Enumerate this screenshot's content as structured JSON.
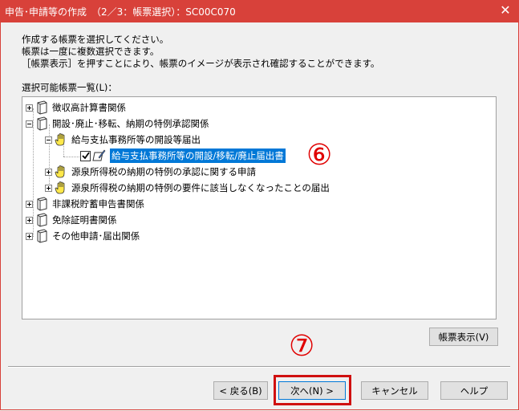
{
  "window": {
    "title": "申告･申請等の作成　（2／3：帳票選択）：SC00C070",
    "close_glyph": "✕"
  },
  "instructions": {
    "line1": "作成する帳票を選択してください。",
    "line2": "帳票は一度に複数選択できます。",
    "line3": "［帳票表示］を押すことにより、帳票のイメージが表示され確認することができます。"
  },
  "list_label": "選択可能帳票一覧(L)：",
  "tree": {
    "items": [
      {
        "label": "徴収高計算書関係",
        "expander": "plus"
      },
      {
        "label": "開設･廃止･移転、納期の特例承認関係",
        "expander": "minus"
      },
      {
        "label": "給与支払事務所等の開設等届出",
        "expander": "minus"
      },
      {
        "label": "給与支払事務所等の開設/移転/廃止届出書",
        "checked": true,
        "selected": true
      },
      {
        "label": "源泉所得税の納期の特例の承認に関する申請",
        "expander": "plus"
      },
      {
        "label": "源泉所得税の納期の特例の要件に該当しなくなったことの届出",
        "expander": "plus"
      },
      {
        "label": "非課税貯蓄申告書関係",
        "expander": "plus"
      },
      {
        "label": "免除証明書関係",
        "expander": "plus"
      },
      {
        "label": "その他申請･届出関係",
        "expander": "plus"
      }
    ]
  },
  "buttons": {
    "preview": "帳票表示(V)",
    "back": "< 戻る(B)",
    "next": "次へ(N) >",
    "cancel": "キャンセル",
    "help": "ヘルプ"
  },
  "annotations": {
    "step6": "⑥",
    "step7": "⑦"
  },
  "colors": {
    "titlebar": "#d8413a",
    "selection": "#0078d7",
    "annotation": "#e00000"
  }
}
